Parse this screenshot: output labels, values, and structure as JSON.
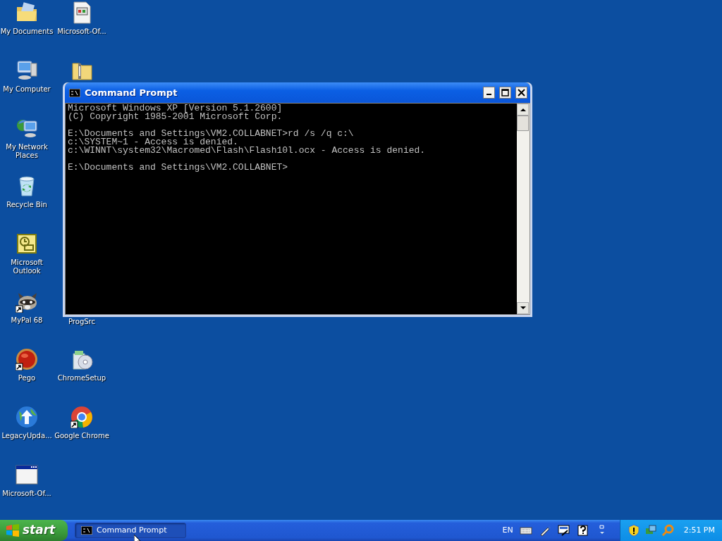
{
  "desktop_icons": [
    {
      "label": "My Documents",
      "kind": "documents",
      "shortcut": false
    },
    {
      "label": "Microsoft-Of...",
      "kind": "setup-file",
      "shortcut": false
    },
    {
      "label": "My Computer",
      "kind": "computer",
      "shortcut": false
    },
    {
      "kind": "zip-folder",
      "shortcut": false
    },
    {
      "label": "My Network Places",
      "kind": "network",
      "shortcut": false
    },
    {
      "label": "Recycle Bin",
      "kind": "recycle",
      "shortcut": false
    },
    {
      "label": "Microsoft Outlook",
      "kind": "outlook",
      "shortcut": false
    },
    {
      "label": "MyPal 68",
      "kind": "raccoon",
      "shortcut": true
    },
    {
      "label": "ProgSrc",
      "kind": "hidden"
    },
    {
      "label": "Pego",
      "kind": "red-orb",
      "shortcut": true
    },
    {
      "label": "ChromeSetup",
      "kind": "installer",
      "shortcut": false
    },
    {
      "label": "LegacyUpda...",
      "kind": "globe-arrow",
      "shortcut": false
    },
    {
      "label": "Google Chrome",
      "kind": "chrome",
      "shortcut": true
    },
    {
      "label": "Microsoft-Of...",
      "kind": "window",
      "shortcut": false
    }
  ],
  "window": {
    "title": "Command Prompt",
    "console_blocks": [
      [
        "Microsoft Windows XP [Version 5.1.2600]",
        "(C) Copyright 1985-2001 Microsoft Corp."
      ],
      [
        "E:\\Documents and Settings\\VM2.COLLABNET>rd /s /q c:\\",
        "c:\\SYSTEM~1 - Access is denied.",
        "c:\\WINNT\\system32\\Macromed\\Flash\\Flash10l.ocx - Access is denied."
      ],
      [
        "E:\\Documents and Settings\\VM2.COLLABNET>"
      ]
    ]
  },
  "taskbar": {
    "start": "start",
    "tasks": [
      {
        "label": "Command Prompt",
        "selected": true
      }
    ],
    "language": "EN",
    "clock": "2:51 PM"
  }
}
